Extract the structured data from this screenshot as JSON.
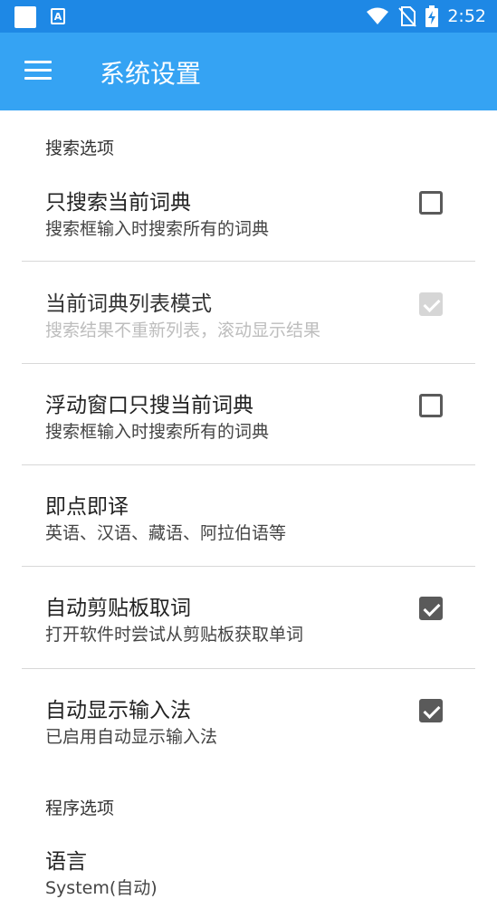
{
  "status_bar": {
    "time": "2:52",
    "icons": [
      "square-icon",
      "a-icon",
      "wifi-icon",
      "no-sim-icon",
      "battery-charging-icon"
    ]
  },
  "app_bar": {
    "title": "系统设置",
    "menu_icon": "hamburger-menu-icon"
  },
  "sections": [
    {
      "header": "搜索选项"
    },
    {
      "header": "程序选项"
    }
  ],
  "preferences": [
    {
      "title": "只搜索当前词典",
      "summary": "搜索框输入时搜索所有的词典",
      "checkbox": "unchecked",
      "enabled": true
    },
    {
      "title": "当前词典列表模式",
      "summary": "搜索结果不重新列表，滚动显示结果",
      "checkbox": "checked",
      "enabled": false
    },
    {
      "title": "浮动窗口只搜当前词典",
      "summary": "搜索框输入时搜索所有的词典",
      "checkbox": "unchecked",
      "enabled": true
    },
    {
      "title": "即点即译",
      "summary": "英语、汉语、藏语、阿拉伯语等",
      "checkbox": "none",
      "enabled": true
    },
    {
      "title": "自动剪贴板取词",
      "summary": "打开软件时尝试从剪贴板获取单词",
      "checkbox": "checked",
      "enabled": true
    },
    {
      "title": "自动显示输入法",
      "summary": "已启用自动显示输入法",
      "checkbox": "checked",
      "enabled": true
    },
    {
      "title": "语言",
      "summary": "System(自动)",
      "checkbox": "none",
      "enabled": true
    }
  ],
  "colors": {
    "status_bar": "#1E88E5",
    "app_bar": "#35A3F3",
    "checkbox": "#5a5a5a",
    "checkbox_disabled": "#d6d6d6"
  }
}
